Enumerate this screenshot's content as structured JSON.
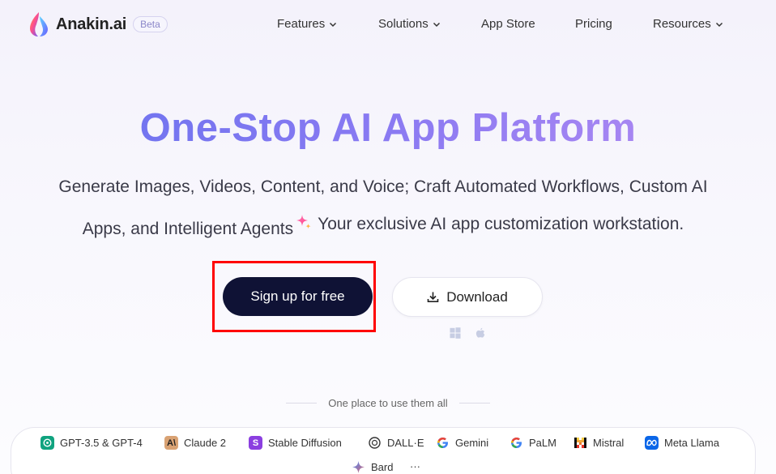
{
  "nav": {
    "brand": "Anakin.ai",
    "badge": "Beta",
    "menu": [
      {
        "label": "Features",
        "dropdown": true
      },
      {
        "label": "Solutions",
        "dropdown": true
      },
      {
        "label": "App Store",
        "dropdown": false
      },
      {
        "label": "Pricing",
        "dropdown": false
      },
      {
        "label": "Resources",
        "dropdown": true
      }
    ]
  },
  "hero": {
    "title": "One-Stop AI App Platform",
    "subtitle_line1": "Generate Images, Videos, Content, and Voice; Craft Automated Workflows, Custom AI",
    "subtitle_line2a": "Apps, and Intelligent Agents",
    "subtitle_line2b": "Your exclusive AI app customization workstation.",
    "signup_label": "Sign up for free",
    "download_label": "Download"
  },
  "models": {
    "caption": "One place to use them all",
    "items": [
      {
        "label": "GPT-3.5 & GPT-4",
        "icon": "openai-icon"
      },
      {
        "label": "Claude 2",
        "icon": "anthropic-icon"
      },
      {
        "label": "Stable Diffusion",
        "icon": "stable-diffusion-icon"
      },
      {
        "label": "DALL·E",
        "icon": "openai-icon"
      },
      {
        "label": "Gemini",
        "icon": "google-icon"
      },
      {
        "label": "PaLM",
        "icon": "google-icon"
      },
      {
        "label": "Mistral",
        "icon": "mistral-icon"
      },
      {
        "label": "Meta Llama",
        "icon": "meta-icon"
      },
      {
        "label": "Bard",
        "icon": "bard-icon"
      },
      {
        "label": "···",
        "icon": "more-icon"
      }
    ]
  },
  "colors": {
    "title_gradient_start": "#6672ee",
    "title_gradient_end": "#b68cf2",
    "signup_bg": "#0f1235",
    "highlight": "#ff0000"
  }
}
